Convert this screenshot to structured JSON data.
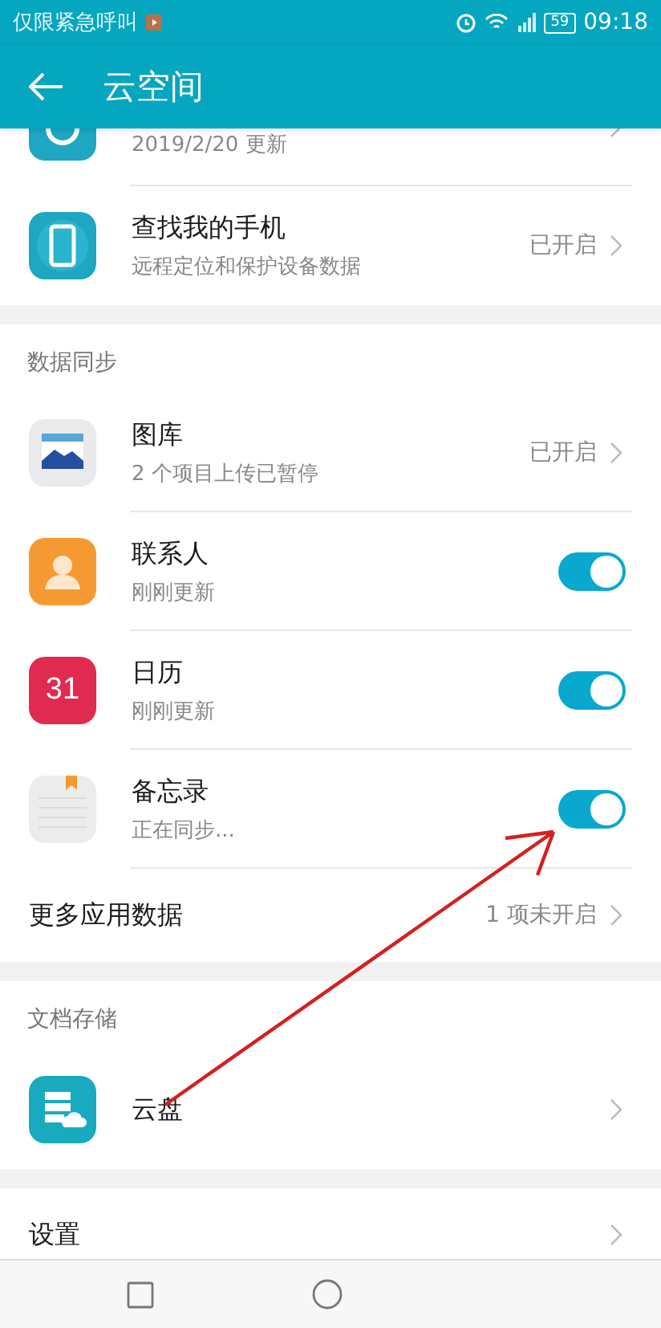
{
  "status_bar": {
    "carrier": "仅限紧急呼叫",
    "battery": "59",
    "time": "09:18"
  },
  "app_bar": {
    "title": "云空间"
  },
  "sections": [
    {
      "rows": [
        {
          "kind": "status",
          "subtitle": "2019/2/20 更新"
        },
        {
          "kind": "status",
          "title": "查找我的手机",
          "subtitle": "远程定位和保护设备数据",
          "status": "已开启"
        }
      ]
    },
    {
      "header": "数据同步",
      "rows": [
        {
          "kind": "status",
          "title": "图库",
          "subtitle": "2 个项目上传已暂停",
          "status": "已开启"
        },
        {
          "kind": "toggle",
          "title": "联系人",
          "subtitle": "刚刚更新",
          "on": true
        },
        {
          "kind": "toggle",
          "icon_text": "31",
          "title": "日历",
          "subtitle": "刚刚更新",
          "on": true
        },
        {
          "kind": "toggle",
          "title": "备忘录",
          "subtitle": "正在同步...",
          "on": true
        },
        {
          "kind": "status",
          "title": "更多应用数据",
          "status": "1 项未开启"
        }
      ]
    },
    {
      "header": "文档存储",
      "rows": [
        {
          "kind": "status",
          "title": "云盘"
        }
      ]
    },
    {
      "rows": [
        {
          "kind": "status",
          "title": "设置"
        }
      ]
    }
  ]
}
